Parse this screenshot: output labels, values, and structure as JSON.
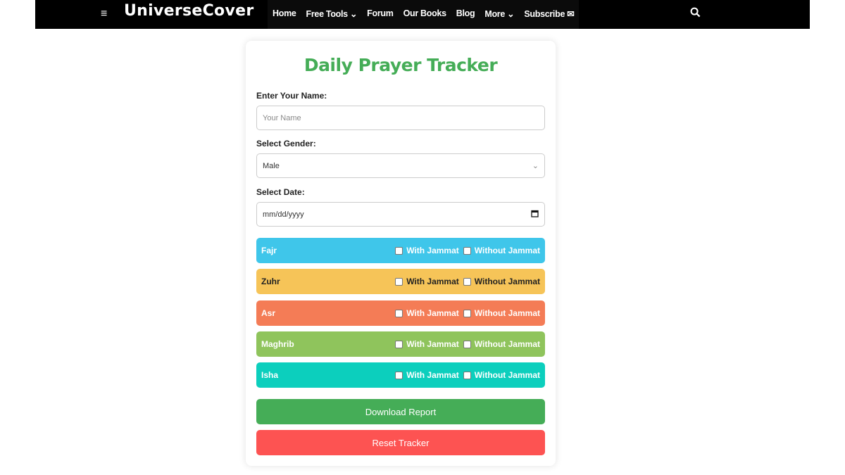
{
  "nav": {
    "logo": "UniverseCover",
    "items": [
      "Home",
      "Free Tools ⌄",
      "Forum",
      "Our Books",
      "Blog",
      "More ⌄",
      "Subscribe ✉"
    ]
  },
  "form": {
    "title": "Daily Prayer Tracker",
    "name_label": "Enter Your Name:",
    "name_placeholder": "Your Name",
    "name_value": "",
    "gender_label": "Select Gender:",
    "gender_value": "Male",
    "date_label": "Select Date:",
    "date_placeholder": "mm/dd/yyyy",
    "with_label": "With Jammat",
    "without_label": "Without Jammat",
    "prayers": [
      {
        "name": "Fajr",
        "color": "#3fc6ea",
        "text": "#ffffff",
        "with": false,
        "without": false
      },
      {
        "name": "Zuhr",
        "color": "#f6c458",
        "text": "#222222",
        "with": false,
        "without": false
      },
      {
        "name": "Asr",
        "color": "#f47c56",
        "text": "#ffffff",
        "with": false,
        "without": false
      },
      {
        "name": "Maghrib",
        "color": "#8fc45c",
        "text": "#ffffff",
        "with": false,
        "without": false
      },
      {
        "name": "Isha",
        "color": "#0ccfbd",
        "text": "#ffffff",
        "with": false,
        "without": false
      }
    ],
    "download_label": "Download Report",
    "download_color": "#45ad57",
    "reset_label": "Reset Tracker",
    "reset_color": "#fd5352"
  }
}
